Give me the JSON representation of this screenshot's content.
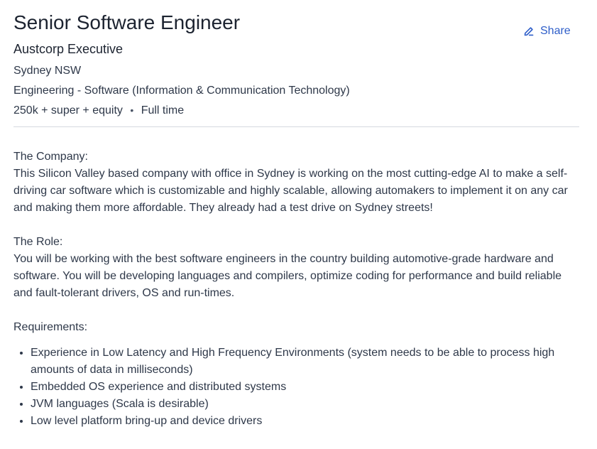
{
  "job": {
    "title": "Senior Software Engineer",
    "company": "Austcorp Executive",
    "location": "Sydney NSW",
    "classification": "Engineering - Software (Information & Communication Technology)",
    "salary": "250k + super + equity",
    "separator": "•",
    "work_type": "Full time"
  },
  "share": {
    "label": "Share",
    "icon": "share-icon"
  },
  "description": {
    "company_heading": "The Company:",
    "company_text": "This Silicon Valley based company with office in Sydney is working on the most cutting-edge AI to make a self-driving car software which is customizable and highly scalable, allowing automakers to implement it on any car and making them more affordable. They already had a test drive on Sydney streets!",
    "role_heading": "The Role:",
    "role_text": "You will be working with the best software engineers in the country building automotive-grade hardware and software. You will be developing languages and compilers, optimize coding for performance and build reliable and fault-tolerant drivers, OS and run-times.",
    "requirements_heading": "Requirements:",
    "requirements": [
      "Experience in Low Latency and High Frequency Environments (system needs to be able to process high amounts of data in milliseconds)",
      "Embedded OS experience and distributed systems",
      "JVM languages (Scala is desirable)",
      "Low level platform bring-up and device drivers"
    ]
  }
}
